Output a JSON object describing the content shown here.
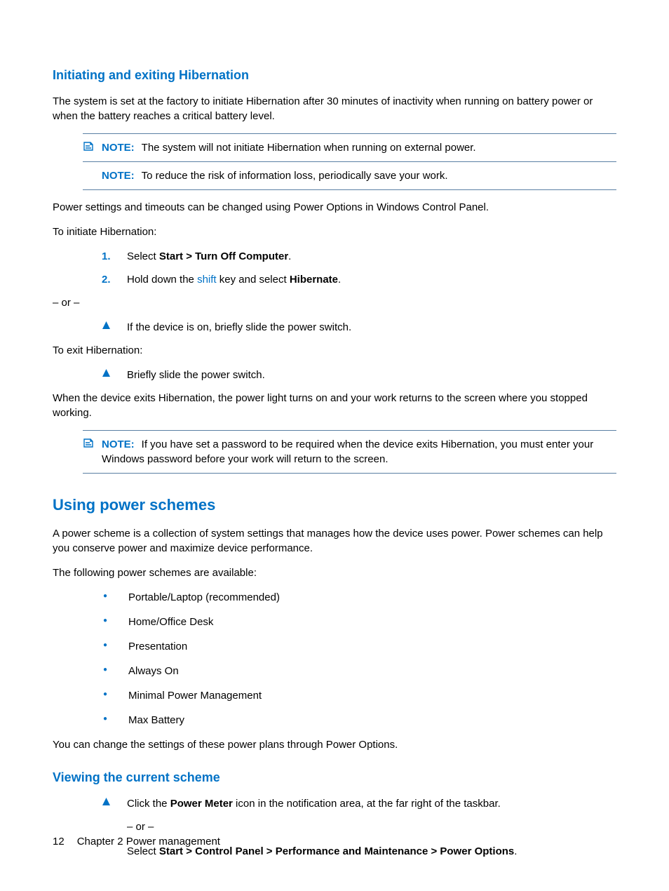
{
  "heading_h1_1": "Initiating and exiting Hibernation",
  "p_intro": "The system is set at the factory to initiate Hibernation after 30 minutes of inactivity when running on battery power or when the battery reaches a critical battery level.",
  "note1_label": "NOTE:",
  "note1_text": "The system will not initiate Hibernation when running on external power.",
  "note2_label": "NOTE:",
  "note2_text": "To reduce the risk of information loss, periodically save your work.",
  "p_settings": "Power settings and timeouts can be changed using Power Options in Windows Control Panel.",
  "p_to_initiate": "To initiate Hibernation:",
  "ol1_num": "1.",
  "ol1_pre": "Select ",
  "ol1_bold": "Start > Turn Off Computer",
  "ol1_post": ".",
  "ol2_num": "2.",
  "ol2_pre": "Hold down the ",
  "ol2_shift": "shift",
  "ol2_mid": " key and select ",
  "ol2_bold": "Hibernate",
  "ol2_post": ".",
  "p_or": "– or –",
  "tri1_text": "If the device is on, briefly slide the power switch.",
  "p_to_exit": "To exit Hibernation:",
  "tri2_text": "Briefly slide the power switch.",
  "p_when_exit": "When the device exits Hibernation, the power light turns on and your work returns to the screen where you stopped working.",
  "note3_label": "NOTE:",
  "note3_text": "If you have set a password to be required when the device exits Hibernation, you must enter your Windows password before your work will return to the screen.",
  "heading_h2": "Using power schemes",
  "p_scheme_intro": "A power scheme is a collection of system settings that manages how the device uses power. Power schemes can help you conserve power and maximize device performance.",
  "p_scheme_avail": "The following power schemes are available:",
  "bullets": [
    "Portable/Laptop (recommended)",
    "Home/Office Desk",
    "Presentation",
    "Always On",
    "Minimal Power Management",
    "Max Battery"
  ],
  "p_change": "You can change the settings of these power plans through Power Options.",
  "heading_h1_2": "Viewing the current scheme",
  "tri3_pre": "Click the ",
  "tri3_bold": "Power Meter",
  "tri3_post": " icon in the notification area, at the far right of the taskbar.",
  "p_or2": "– or –",
  "p_select_pre": "Select ",
  "p_select_bold": "Start > Control Panel > Performance and Maintenance > Power Options",
  "p_select_post": ".",
  "footer_page": "12",
  "footer_chapter": "Chapter 2   Power management"
}
